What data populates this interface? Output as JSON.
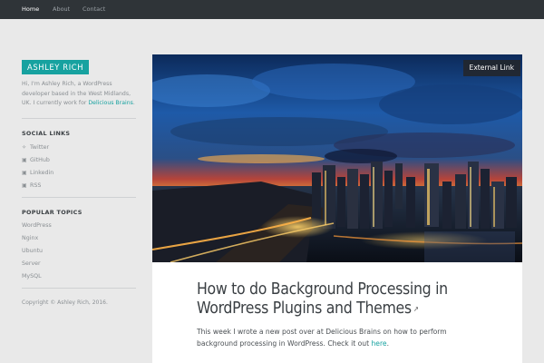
{
  "nav": {
    "items": [
      {
        "label": "Home",
        "active": true
      },
      {
        "label": "About",
        "active": false
      },
      {
        "label": "Contact",
        "active": false
      }
    ]
  },
  "sidebar": {
    "site_title": "ASHLEY RICH",
    "bio_text": "Hi, I'm Ashley Rich, a WordPress developer based in the West Midlands, UK. I currently work for ",
    "bio_link": "Delicious Brains",
    "bio_end": ".",
    "social_heading": "SOCIAL LINKS",
    "social_links": [
      {
        "label": "Twitter",
        "icon": "twitter-icon"
      },
      {
        "label": "GitHub",
        "icon": "github-icon"
      },
      {
        "label": "Linkedin",
        "icon": "linkedin-icon"
      },
      {
        "label": "RSS",
        "icon": "rss-icon"
      }
    ],
    "topics_heading": "POPULAR TOPICS",
    "topics": [
      "WordPress",
      "Nginx",
      "Ubuntu",
      "Server",
      "MySQL"
    ],
    "copyright": "Copyright © Ashley Rich, 2016."
  },
  "post": {
    "badge": "External Link",
    "title": "How to do Background Processing in WordPress Plugins and Themes",
    "external_icon": "external-link-icon",
    "excerpt_text": "This week I wrote a new post over at Delicious Brains on how to perform background processing in WordPress. Check it out ",
    "excerpt_link": "here",
    "excerpt_end": "."
  },
  "colors": {
    "accent": "#17a2a0",
    "nav_bg": "#2f3438",
    "page_bg": "#e9e9e9"
  }
}
